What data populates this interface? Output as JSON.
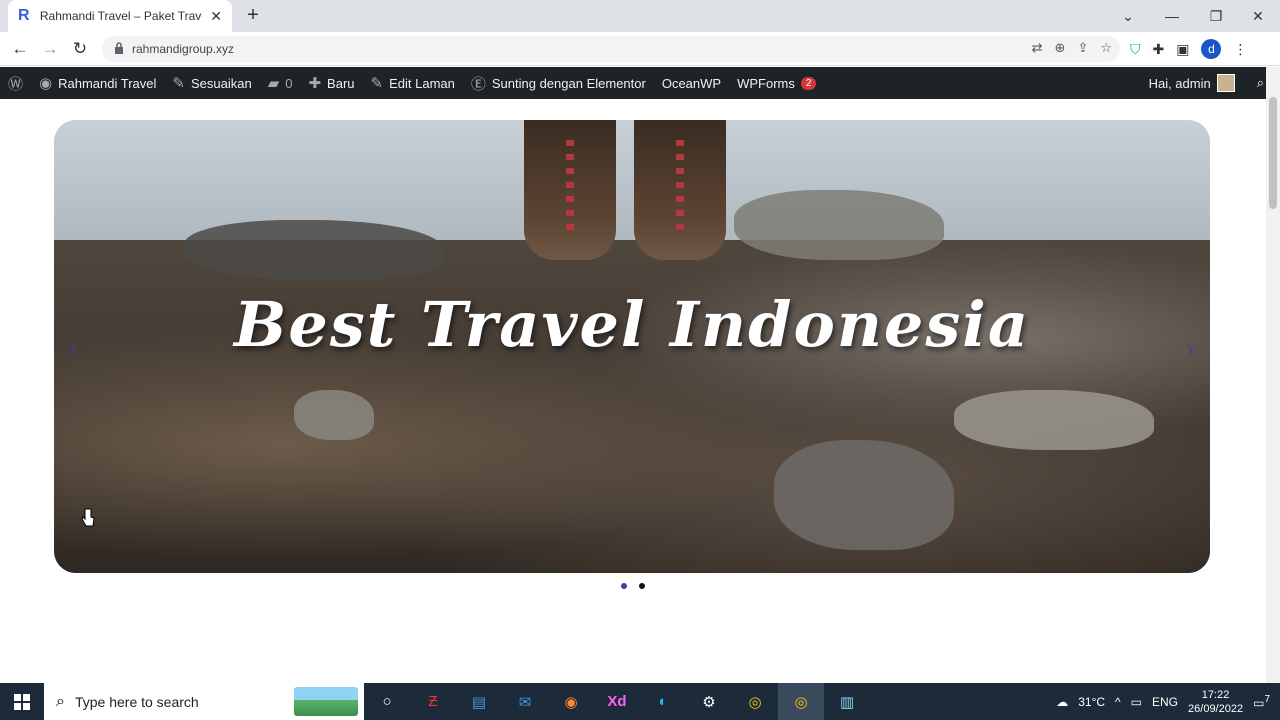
{
  "browser": {
    "tab_favicon": "R",
    "tab_title": "Rahmandi Travel – Paket Travel Te",
    "new_tab_label": "+",
    "url": "rahmandigroup.xyz",
    "profile_initial": "d"
  },
  "adminbar": {
    "site_name": "Rahmandi Travel",
    "customize": "Sesuaikan",
    "comments_count": "0",
    "new": "Baru",
    "edit_page": "Edit Laman",
    "elementor": "Sunting dengan Elementor",
    "oceanwp": "OceanWP",
    "wpforms": "WPForms",
    "wpforms_badge": "2",
    "greeting": "Hai, admin"
  },
  "slider": {
    "title": "Best Travel Indonesia",
    "prev_arrow": "‹",
    "next_arrow": "›",
    "dot_count": 2,
    "active_dot": 1
  },
  "taskbar": {
    "search_placeholder": "Type here to search",
    "weather": "31°C",
    "language": "ENG",
    "time": "17:22",
    "date": "26/09/2022",
    "notification_count": "7"
  },
  "colors": {
    "adminbar_bg": "#1d2327",
    "badge": "#d63638",
    "slider_accent": "#3b3fa5",
    "taskbar_bg": "#1c2a3a"
  }
}
